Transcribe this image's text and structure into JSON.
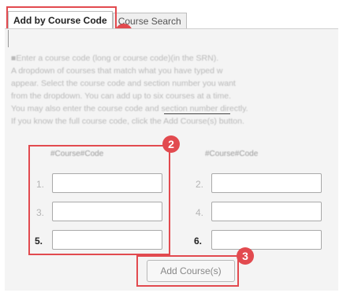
{
  "tabs": [
    {
      "label": "Add by Course Code",
      "active": true
    },
    {
      "label": "Course Search",
      "active": false
    }
  ],
  "instructions_lines": [
    "■Enter a course code (long or course code)(in the SRN).",
    "A dropdown of courses that match what you have typed w",
    "appear. Select the course code and section number you want",
    "from the dropdown. You can add up to six courses at a time.",
    "You may also enter the course code and section number directly.",
    "If you know the full course code, click the Add Course(s) button."
  ],
  "columns": {
    "left_header": "#Course#Code",
    "right_header": "#Course#Code"
  },
  "rows": [
    {
      "left_label": "1.",
      "right_label": "2."
    },
    {
      "left_label": "3.",
      "right_label": "4."
    },
    {
      "left_label": "5.",
      "right_label": "6."
    }
  ],
  "fields": {
    "left": [
      "",
      "",
      ""
    ],
    "right": [
      "",
      "",
      ""
    ]
  },
  "add_button": {
    "label": "Add Course(s)"
  },
  "callouts": [
    "1",
    "2",
    "3"
  ],
  "colors": {
    "callout": "#e24a4f",
    "panel": "#f4f4f4"
  }
}
